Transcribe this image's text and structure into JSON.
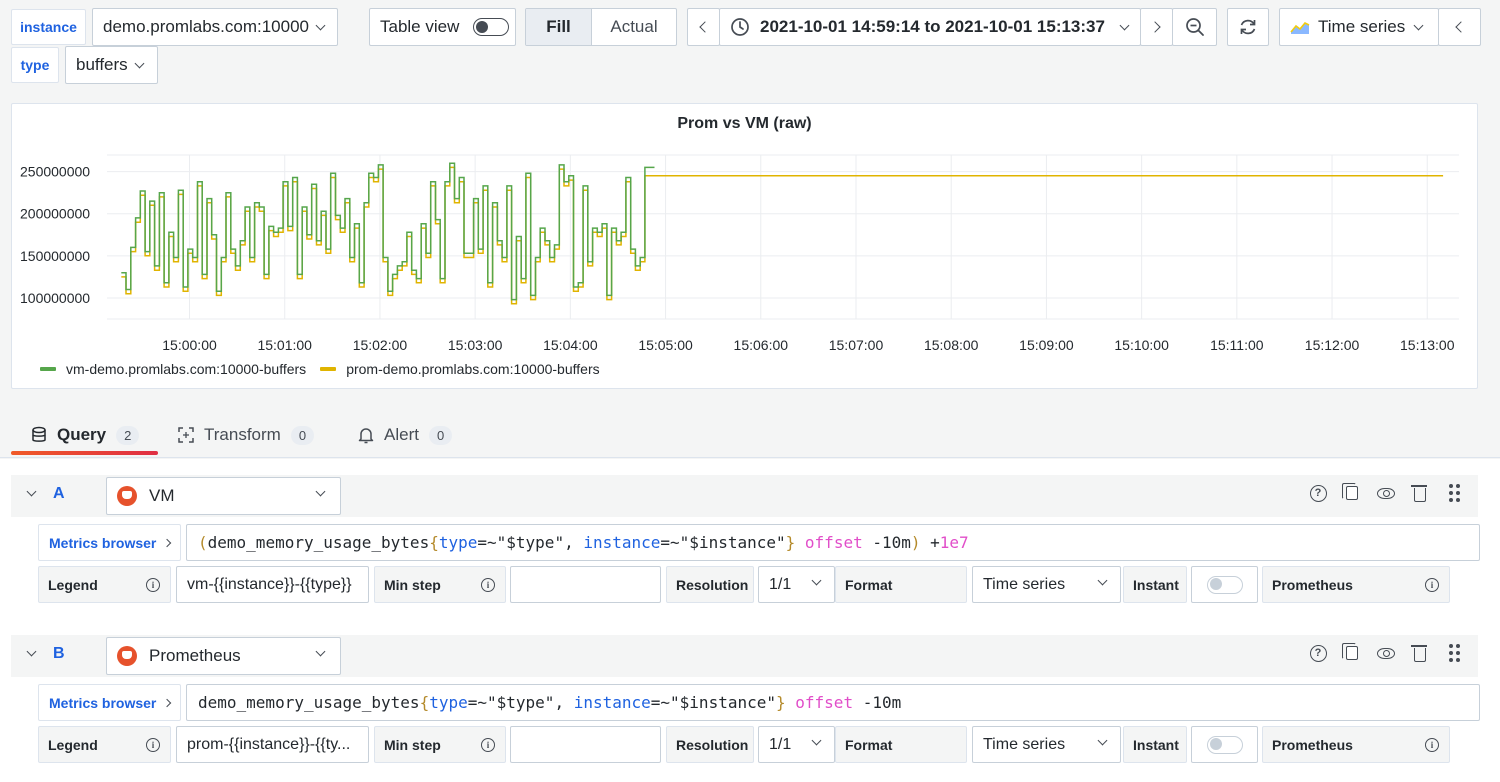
{
  "variables": [
    {
      "label": "instance",
      "value": "demo.promlabs.com:10000"
    },
    {
      "label": "type",
      "value": "buffers"
    }
  ],
  "toolbar": {
    "table_view_label": "Table view",
    "fill_label": "Fill",
    "actual_label": "Actual",
    "time_range": "2021-10-01 14:59:14 to 2021-10-01 15:13:37",
    "visualization": "Time series"
  },
  "panel": {
    "title": "Prom vs VM (raw)"
  },
  "chart_data": {
    "type": "line",
    "title": "Prom vs VM (raw)",
    "xlabel": "",
    "ylabel": "",
    "ylim": [
      75000000,
      265000000
    ],
    "x_ticks": [
      "15:00:00",
      "15:01:00",
      "15:02:00",
      "15:03:00",
      "15:04:00",
      "15:05:00",
      "15:06:00",
      "15:07:00",
      "15:08:00",
      "15:09:00",
      "15:10:00",
      "15:11:00",
      "15:12:00",
      "15:13:00"
    ],
    "y_ticks": [
      "100000000",
      "150000000",
      "200000000",
      "250000000"
    ],
    "y_tick_values": [
      100000000,
      150000000,
      200000000,
      250000000
    ],
    "x_range_seconds": [
      -52,
      800
    ],
    "grid": true,
    "legend_position": "bottom-left",
    "series": [
      {
        "name": "vm-demo.promlabs.com:10000-buffers",
        "color": "#56a64b",
        "step": 3,
        "start_seconds": -43,
        "values": [
          130000000,
          110000000,
          160000000,
          195000000,
          227000000,
          155000000,
          215000000,
          138000000,
          225000000,
          118000000,
          178000000,
          148000000,
          228000000,
          113000000,
          158000000,
          148000000,
          238000000,
          128000000,
          218000000,
          175000000,
          108000000,
          148000000,
          225000000,
          158000000,
          138000000,
          168000000,
          208000000,
          148000000,
          213000000,
          208000000,
          128000000,
          185000000,
          178000000,
          183000000,
          238000000,
          185000000,
          243000000,
          128000000,
          208000000,
          175000000,
          235000000,
          168000000,
          203000000,
          158000000,
          248000000,
          198000000,
          183000000,
          218000000,
          148000000,
          188000000,
          118000000,
          213000000,
          248000000,
          243000000,
          258000000,
          148000000,
          108000000,
          128000000,
          138000000,
          143000000,
          178000000,
          133000000,
          123000000,
          188000000,
          153000000,
          238000000,
          193000000,
          123000000,
          238000000,
          260000000,
          218000000,
          243000000,
          153000000,
          153000000,
          218000000,
          158000000,
          233000000,
          118000000,
          213000000,
          168000000,
          148000000,
          233000000,
          98000000,
          173000000,
          123000000,
          248000000,
          103000000,
          148000000,
          183000000,
          168000000,
          148000000,
          163000000,
          258000000,
          238000000,
          245000000,
          113000000,
          118000000,
          233000000,
          143000000,
          183000000,
          178000000,
          188000000,
          103000000,
          183000000,
          168000000,
          178000000,
          243000000,
          158000000,
          138000000,
          148000000,
          255000000,
          255000000
        ]
      },
      {
        "name": "prom-demo.promlabs.com:10000-buffers",
        "color": "#e0b400",
        "step": 3,
        "start_seconds": -43,
        "values": [
          125000000,
          105000000,
          155000000,
          190000000,
          222000000,
          150000000,
          210000000,
          133000000,
          220000000,
          113000000,
          173000000,
          143000000,
          223000000,
          108000000,
          153000000,
          143000000,
          233000000,
          123000000,
          213000000,
          170000000,
          103000000,
          143000000,
          220000000,
          153000000,
          133000000,
          163000000,
          203000000,
          143000000,
          208000000,
          203000000,
          123000000,
          180000000,
          173000000,
          178000000,
          233000000,
          180000000,
          238000000,
          123000000,
          203000000,
          170000000,
          230000000,
          163000000,
          198000000,
          153000000,
          243000000,
          193000000,
          178000000,
          213000000,
          143000000,
          183000000,
          113000000,
          208000000,
          243000000,
          238000000,
          253000000,
          143000000,
          103000000,
          123000000,
          133000000,
          138000000,
          173000000,
          128000000,
          118000000,
          183000000,
          148000000,
          233000000,
          188000000,
          118000000,
          233000000,
          255000000,
          213000000,
          238000000,
          148000000,
          148000000,
          213000000,
          153000000,
          228000000,
          113000000,
          208000000,
          163000000,
          143000000,
          228000000,
          93000000,
          168000000,
          118000000,
          243000000,
          98000000,
          143000000,
          178000000,
          163000000,
          143000000,
          158000000,
          253000000,
          233000000,
          240000000,
          108000000,
          113000000,
          228000000,
          138000000,
          178000000,
          173000000,
          183000000,
          98000000,
          178000000,
          163000000,
          173000000,
          238000000,
          153000000,
          133000000,
          143000000,
          245000000
        ],
        "flat_until_seconds": 790,
        "flat_value": 245000000
      }
    ]
  },
  "editor_tabs": [
    {
      "label": "Query",
      "count": "2"
    },
    {
      "label": "Transform",
      "count": "0"
    },
    {
      "label": "Alert",
      "count": "0"
    }
  ],
  "queries": [
    {
      "letter": "A",
      "datasource": "VM",
      "metrics_browser": "Metrics browser",
      "expr_tokens": [
        {
          "t": "(",
          "c": "t-paren"
        },
        {
          "t": "demo_memory_usage_bytes",
          "c": "t-metric"
        },
        {
          "t": "{",
          "c": "t-brace"
        },
        {
          "t": "type",
          "c": "t-label"
        },
        {
          "t": "=~",
          "c": "t-op"
        },
        {
          "t": "\"$type\"",
          "c": "t-str"
        },
        {
          "t": ", ",
          "c": "t-op"
        },
        {
          "t": "instance",
          "c": "t-label"
        },
        {
          "t": "=~",
          "c": "t-op"
        },
        {
          "t": "\"$instance\"",
          "c": "t-str"
        },
        {
          "t": "}",
          "c": "t-brace"
        },
        {
          "t": " offset ",
          "c": "t-kw"
        },
        {
          "t": "-10m",
          "c": "t-op"
        },
        {
          "t": ")",
          "c": "t-paren"
        },
        {
          "t": " +",
          "c": "t-op"
        },
        {
          "t": "1e7",
          "c": "t-num"
        }
      ],
      "legend_label": "Legend",
      "legend_value": "vm-{{instance}}-{{type}}",
      "min_step_label": "Min step",
      "min_step_value": "",
      "resolution_label": "Resolution",
      "resolution_value": "1/1",
      "format_label": "Format",
      "format_value": "Time series",
      "instant_label": "Instant",
      "type_label": "Prometheus"
    },
    {
      "letter": "B",
      "datasource": "Prometheus",
      "metrics_browser": "Metrics browser",
      "expr_tokens": [
        {
          "t": "demo_memory_usage_bytes",
          "c": "t-metric"
        },
        {
          "t": "{",
          "c": "t-brace"
        },
        {
          "t": "type",
          "c": "t-label"
        },
        {
          "t": "=~",
          "c": "t-op"
        },
        {
          "t": "\"$type\"",
          "c": "t-str"
        },
        {
          "t": ", ",
          "c": "t-op"
        },
        {
          "t": "instance",
          "c": "t-label"
        },
        {
          "t": "=~",
          "c": "t-op"
        },
        {
          "t": "\"$instance\"",
          "c": "t-str"
        },
        {
          "t": "}",
          "c": "t-brace"
        },
        {
          "t": " offset ",
          "c": "t-kw"
        },
        {
          "t": "-10m",
          "c": "t-op"
        }
      ],
      "legend_label": "Legend",
      "legend_value": "prom-{{instance}}-{{ty...",
      "min_step_label": "Min step",
      "min_step_value": "",
      "resolution_label": "Resolution",
      "resolution_value": "1/1",
      "format_label": "Format",
      "format_value": "Time series",
      "instant_label": "Instant",
      "type_label": "Prometheus"
    }
  ]
}
